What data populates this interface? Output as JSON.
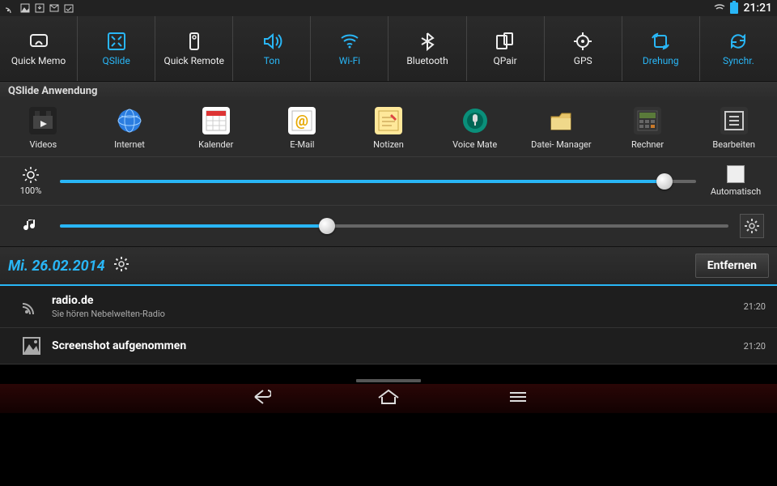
{
  "status": {
    "time": "21:21"
  },
  "toggles": [
    {
      "label": "Quick Memo",
      "active": false,
      "icon": "qmemo"
    },
    {
      "label": "QSlide",
      "active": true,
      "icon": "qslide"
    },
    {
      "label": "Quick Remote",
      "active": false,
      "icon": "remote"
    },
    {
      "label": "Ton",
      "active": true,
      "icon": "sound"
    },
    {
      "label": "Wi-Fi",
      "active": true,
      "icon": "wifi"
    },
    {
      "label": "Bluetooth",
      "active": false,
      "icon": "bluetooth"
    },
    {
      "label": "QPair",
      "active": false,
      "icon": "qpair"
    },
    {
      "label": "GPS",
      "active": false,
      "icon": "gps"
    },
    {
      "label": "Drehung",
      "active": true,
      "icon": "rotate"
    },
    {
      "label": "Synchr.",
      "active": true,
      "icon": "sync"
    }
  ],
  "qslide": {
    "title": "QSlide Anwendung",
    "apps": [
      {
        "label": "Videos"
      },
      {
        "label": "Internet"
      },
      {
        "label": "Kalender"
      },
      {
        "label": "E-Mail"
      },
      {
        "label": "Notizen"
      },
      {
        "label": "Voice Mate"
      },
      {
        "label": "Datei- Manager"
      },
      {
        "label": "Rechner"
      },
      {
        "label": "Bearbeiten"
      }
    ]
  },
  "brightness": {
    "percent_label": "100%",
    "value": 95,
    "auto_label": "Automatisch",
    "auto_checked": false
  },
  "volume": {
    "value": 40
  },
  "date": {
    "text": "Mi. 26.02.2014",
    "clear_label": "Entfernen"
  },
  "notifications": [
    {
      "title": "radio.de",
      "subtitle": "Sie hören Nebelwelten-Radio",
      "time": "21:20",
      "icon": "radio"
    },
    {
      "title": "Screenshot aufgenommen",
      "subtitle": "",
      "time": "21:20",
      "icon": "image"
    }
  ]
}
